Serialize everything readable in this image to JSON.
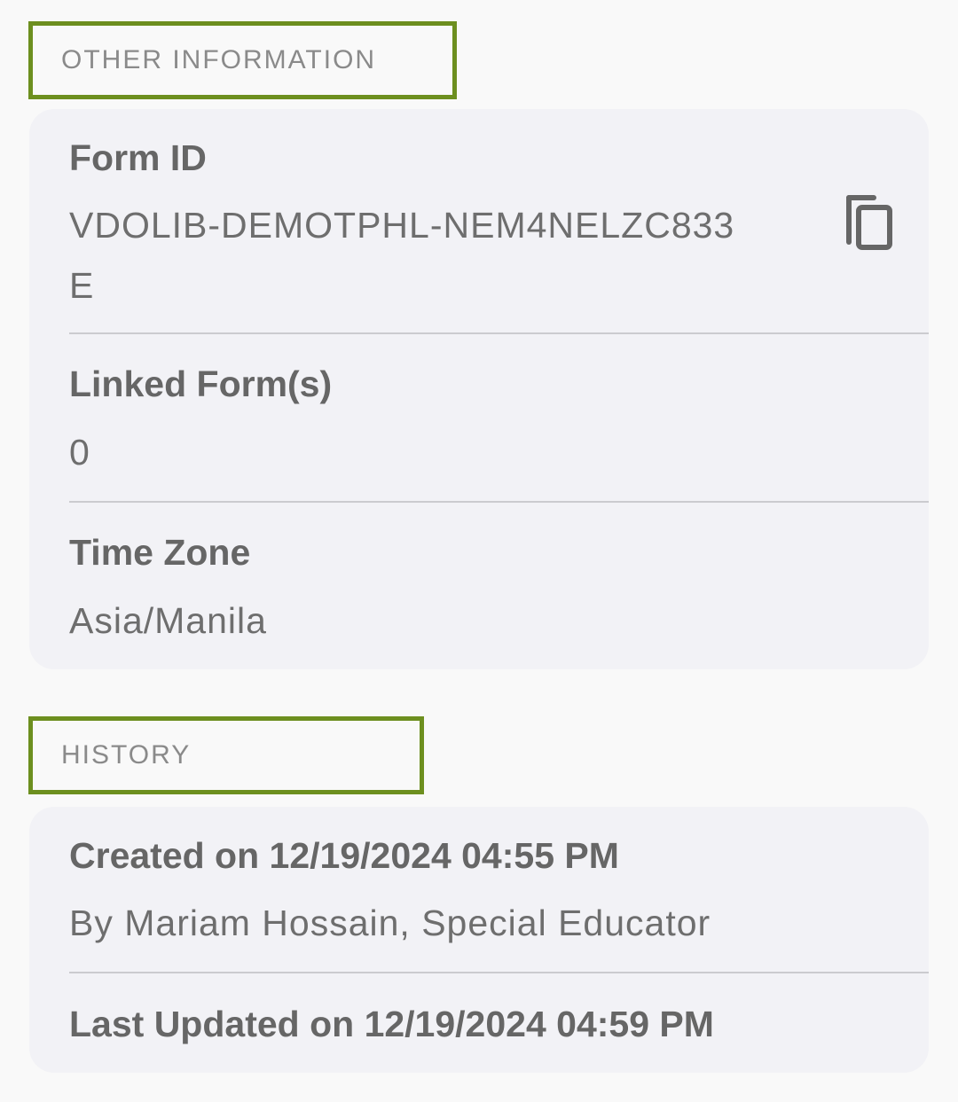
{
  "other_information": {
    "header": "OTHER INFORMATION",
    "form_id": {
      "label": "Form ID",
      "value_line1": "VDOLIB-DEMOTPHL-NEM4NELZC833",
      "value_line2": "E",
      "copy_icon": "copy-icon"
    },
    "linked_forms": {
      "label": "Linked Form(s)",
      "value": "0"
    },
    "time_zone": {
      "label": "Time Zone",
      "value": "Asia/Manila"
    }
  },
  "history": {
    "header": "HISTORY",
    "created": {
      "label": "Created on 12/19/2024 04:55 PM",
      "by": "By Mariam Hossain, Special Educator"
    },
    "last_updated": {
      "label": "Last Updated on 12/19/2024 04:59 PM"
    }
  },
  "colors": {
    "highlight_border": "#6d8f1f",
    "card_background": "#f2f2f6",
    "page_background": "#f9f9f9"
  }
}
